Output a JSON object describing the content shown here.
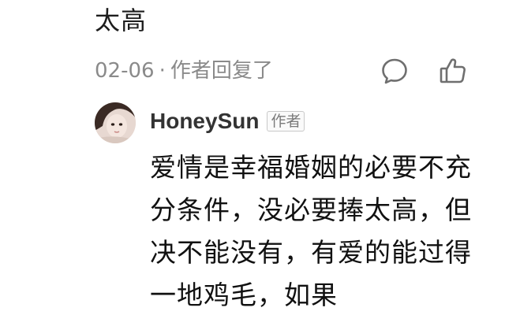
{
  "previous_comment": {
    "text_tail": "太高"
  },
  "reply_meta": {
    "date": "02-06",
    "separator": "·",
    "action": "作者回复了"
  },
  "icons": {
    "comment": "comment-bubble-icon",
    "like": "thumbs-up-icon"
  },
  "reply": {
    "author_name": "HoneySun",
    "author_badge": "作者",
    "text": "爱情是幸福婚姻的必要不充分条件，没必要捧太高，但决不能没有，有爱的能过得一地鸡毛，如果"
  },
  "colors": {
    "meta_gray": "#8a8a8a",
    "text": "#111111",
    "name": "#333333"
  }
}
